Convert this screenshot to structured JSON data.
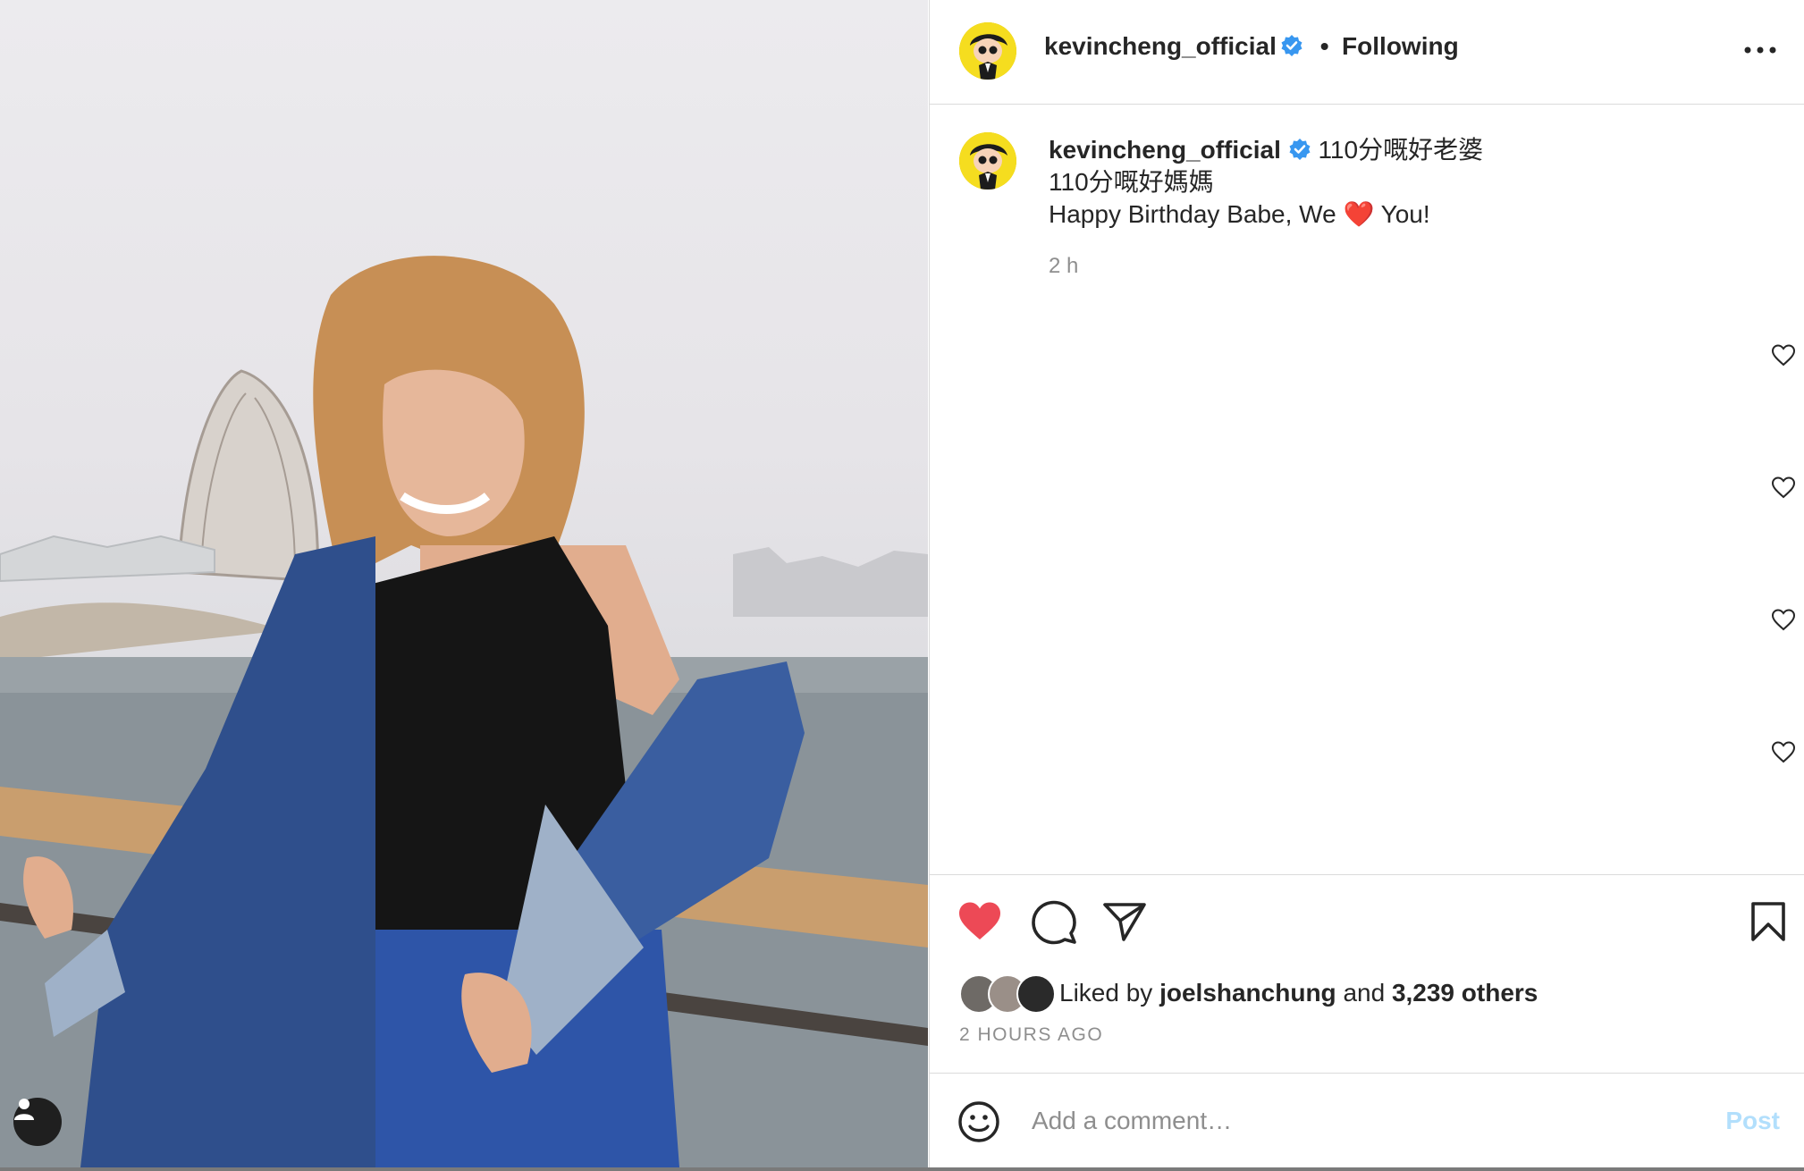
{
  "post": {
    "username": "kevincheng_official",
    "follow_status": "Following",
    "separator": "•",
    "caption_lines": [
      "110分嘅好老婆",
      "110分嘅好媽媽"
    ],
    "caption_line3_before": "Happy Birthday Babe, We ",
    "caption_line3_emoji": "❤️",
    "caption_line3_after": " You!",
    "caption_time": "2 h",
    "liked_by_prefix": "Liked by",
    "liked_by_user": "joelshanchung",
    "liked_by_and": "and",
    "liked_by_others": "3,239 others",
    "timestamp": "2 HOURS AGO",
    "comment_placeholder": "Add a comment…",
    "post_label": "Post"
  },
  "colors": {
    "like_red": "#ed4956",
    "verified_blue": "#3897f0",
    "post_disabled": "#b2dffc",
    "avatar_yellow": "#f5dd1f"
  },
  "icons": [
    "user-tag-icon",
    "verified-badge-icon",
    "more-options-icon",
    "heart-icon",
    "comment-icon",
    "share-icon",
    "bookmark-icon",
    "emoji-icon"
  ]
}
